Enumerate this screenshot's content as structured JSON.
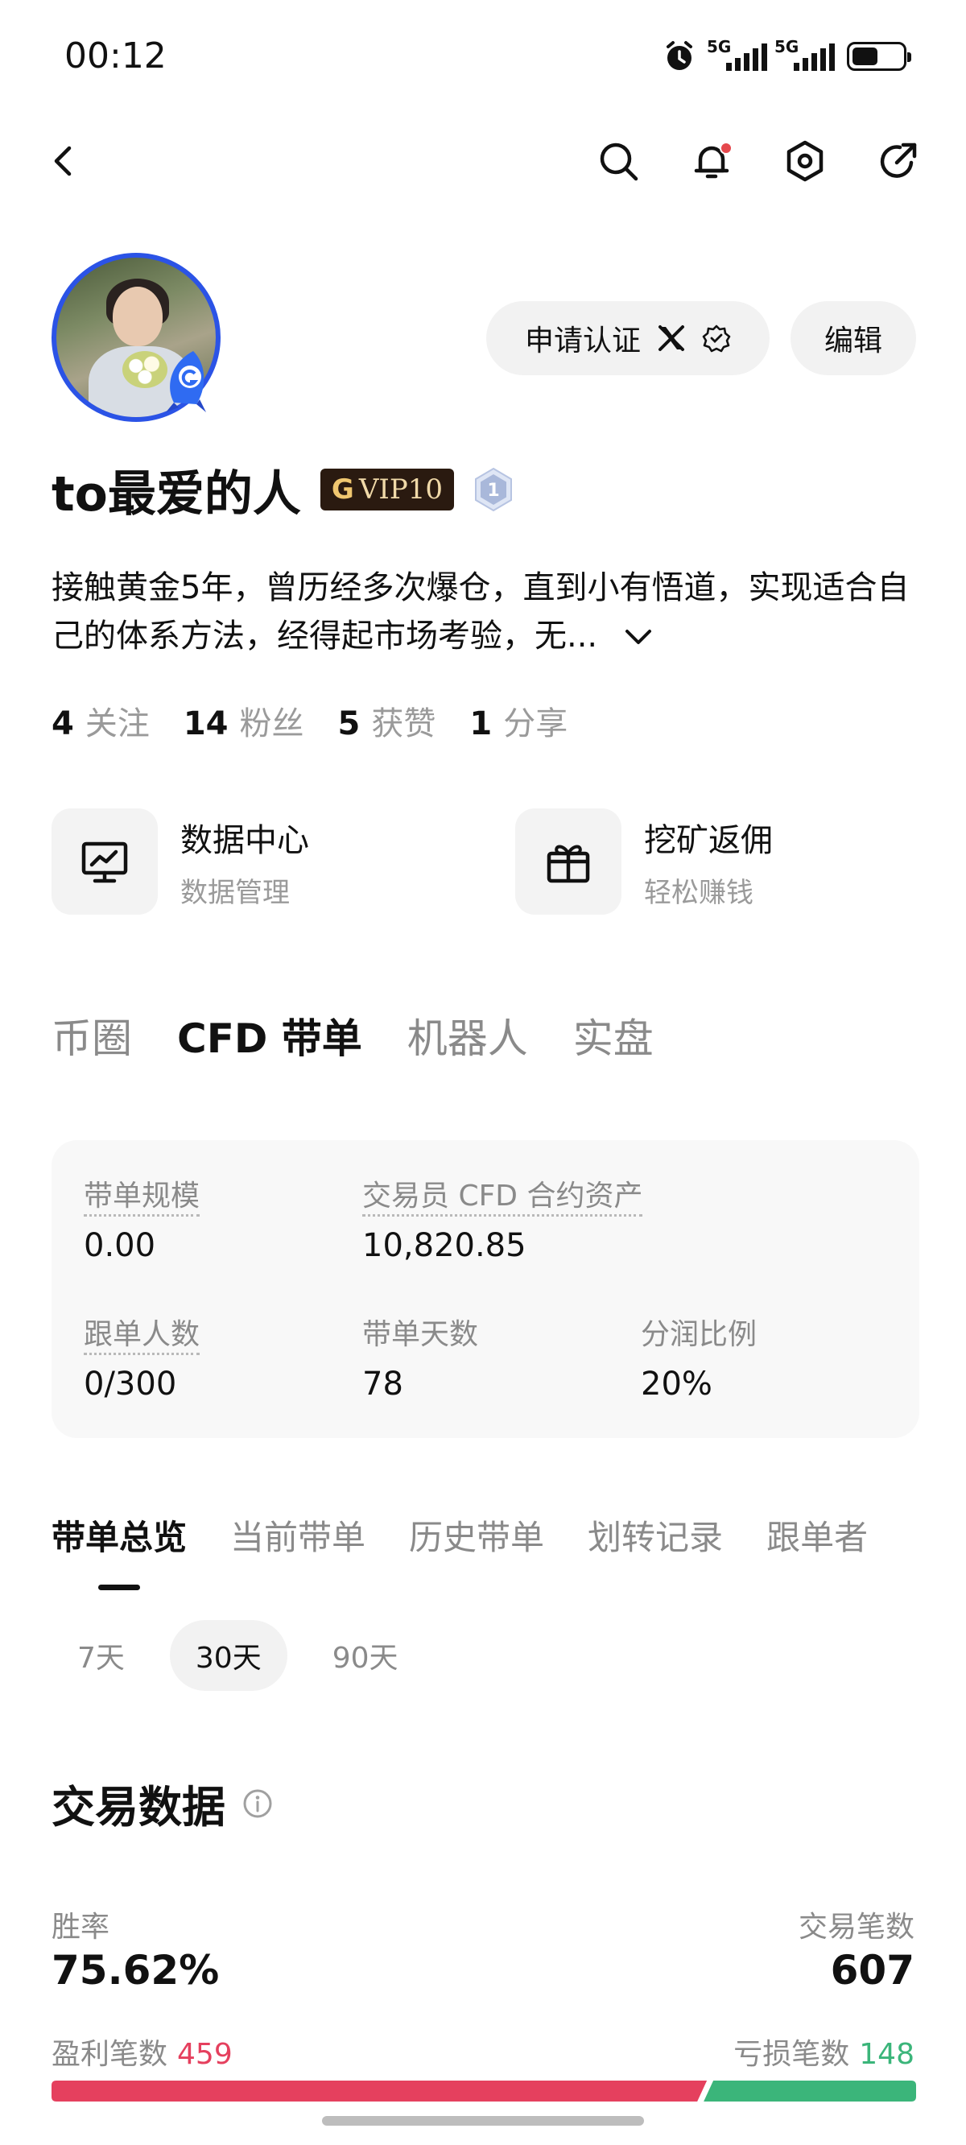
{
  "status_bar": {
    "time": "00:12",
    "net1": "5G",
    "net2": "5G",
    "battery_level": 0.52,
    "icons": [
      "alarm-icon",
      "signal-icon",
      "signal-icon",
      "battery-icon"
    ]
  },
  "nav": {
    "icons": [
      "back-icon",
      "search-icon",
      "bell-icon",
      "settings-icon",
      "share-icon"
    ],
    "has_notification": true,
    "notification_color": "#e5484d"
  },
  "profile": {
    "apply_cert_label": "申请认证",
    "edit_label": "编辑",
    "username": "to最爱的人",
    "vip_glyph": "G",
    "vip_label": "VIP10",
    "level_badge": "1",
    "bio": "接触黄金5年，曾历经多次爆仓，直到小有悟道，实现适合自己的体系方法，经得起市场考验，无...",
    "avatar_border_color": "#2b53e6"
  },
  "stats": [
    {
      "value": "4",
      "label": "关注"
    },
    {
      "value": "14",
      "label": "粉丝"
    },
    {
      "value": "5",
      "label": "获赞"
    },
    {
      "value": "1",
      "label": "分享"
    }
  ],
  "features": [
    {
      "title": "数据中心",
      "subtitle": "数据管理",
      "icon": "monitor-chart-icon"
    },
    {
      "title": "挖矿返佣",
      "subtitle": "轻松赚钱",
      "icon": "gift-icon"
    }
  ],
  "main_tabs": [
    {
      "label": "币圈",
      "active": false
    },
    {
      "label": "CFD 带单",
      "active": true
    },
    {
      "label": "机器人",
      "active": false
    },
    {
      "label": "实盘",
      "active": false
    }
  ],
  "card": {
    "scale_label": "带单规模",
    "scale_value": "0.00",
    "assets_label": "交易员 CFD 合约资产",
    "assets_value": "10,820.85",
    "followers_label": "跟单人数",
    "followers_value": "0/300",
    "days_label": "带单天数",
    "days_value": "78",
    "share_label": "分润比例",
    "share_value": "20%"
  },
  "sub_tabs": [
    {
      "label": "带单总览",
      "active": true
    },
    {
      "label": "当前带单",
      "active": false
    },
    {
      "label": "历史带单",
      "active": false
    },
    {
      "label": "划转记录",
      "active": false
    },
    {
      "label": "跟单者",
      "active": false
    }
  ],
  "periods": [
    {
      "label": "7天",
      "active": false
    },
    {
      "label": "30天",
      "active": true
    },
    {
      "label": "90天",
      "active": false
    }
  ],
  "trading": {
    "title": "交易数据",
    "win_rate_label": "胜率",
    "win_rate_value": "75.62%",
    "trades_label": "交易笔数",
    "trades_value": "607",
    "profit_label": "盈利笔数",
    "profit_count": "459",
    "loss_label": "亏损笔数",
    "loss_count": "148",
    "profit_color": "#e5405e",
    "loss_color": "#3bb57a"
  }
}
